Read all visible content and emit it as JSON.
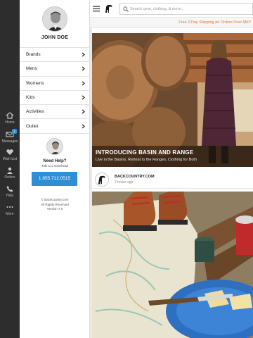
{
  "rail": {
    "items": [
      {
        "label": "Home",
        "icon": "home-icon"
      },
      {
        "label": "Messages",
        "icon": "messages-icon",
        "badge": "1"
      },
      {
        "label": "Wish List",
        "icon": "heart-icon"
      },
      {
        "label": "Orders",
        "icon": "person-icon"
      },
      {
        "label": "Help",
        "icon": "phone-icon"
      },
      {
        "label": "More",
        "icon": "more-icon"
      }
    ]
  },
  "menu": {
    "username": "JOHN DOE",
    "items": [
      {
        "label": "Brands"
      },
      {
        "label": "Mens"
      },
      {
        "label": "Womens"
      },
      {
        "label": "Kids"
      },
      {
        "label": "Activities"
      },
      {
        "label": "Outlet"
      }
    ],
    "need_help": "Need Help?",
    "talk_to": "Talk to a Gearhead",
    "phone": "1.855.712.0515",
    "legal_1": "© Backcountry.com",
    "legal_2": "All Rights Reserved",
    "legal_3": "Version 7.0"
  },
  "header": {
    "search_placeholder": "Search gear, clothing, & more..."
  },
  "promo": "Free 2-Day Shipping on Orders Over $50*",
  "hero": {
    "title": "INTRODUCING BASIN AND RANGE",
    "subtitle": "Live in the Basins, Retreat to the Ranges, Clothing for Both"
  },
  "post": {
    "name": "BACKCOUNTRY.COM",
    "time": "2 hours ago"
  },
  "colors": {
    "accent_blue": "#2f8fd6",
    "promo_orange": "#e8722c",
    "rail_dark": "#2d2d2d"
  }
}
